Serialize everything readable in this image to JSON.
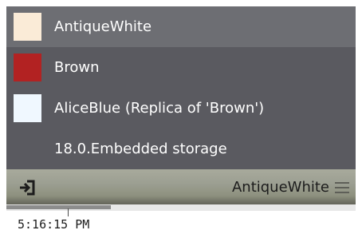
{
  "list": {
    "items": [
      {
        "label": "AntiqueWhite",
        "swatch_color": "#FAEBD7",
        "highlighted": true
      },
      {
        "label": "Brown",
        "swatch_color": "#B22222",
        "highlighted": false
      },
      {
        "label": "AliceBlue (Replica of 'Brown')",
        "swatch_color": "#F0F8FF",
        "highlighted": false
      },
      {
        "label": "18.0.Embedded storage",
        "swatch_color": null,
        "highlighted": false
      }
    ]
  },
  "footer": {
    "exit_icon": "exit-icon",
    "current_value": "AntiqueWhite",
    "menu_icon": "hamburger-menu-icon"
  },
  "status": {
    "progress_fraction": 0.3,
    "time": "5:16:15 PM"
  },
  "colors": {
    "panel_bg": "#5a5a60",
    "highlight_bg": "#6d6e73",
    "item_text": "#ffffff"
  }
}
